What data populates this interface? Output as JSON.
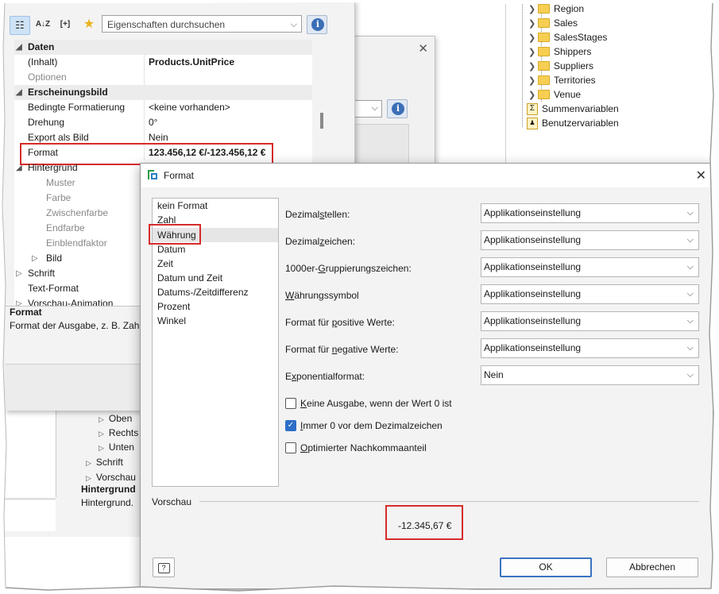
{
  "tree": {
    "items": [
      {
        "label": "Region"
      },
      {
        "label": "Sales"
      },
      {
        "label": "SalesStages"
      },
      {
        "label": "Shippers"
      },
      {
        "label": "Suppliers"
      },
      {
        "label": "Territories"
      },
      {
        "label": "Venue"
      }
    ],
    "sum_vars": "Summenvariablen",
    "user_vars": "Benutzervariablen"
  },
  "props": {
    "search_placeholder": "Eigenschaften durchsuchen",
    "sort_icon_label": "A↓Z",
    "bracket_label": "[+]",
    "rows": [
      {
        "key": "Daten",
        "value": ""
      },
      {
        "key": "(Inhalt)",
        "value": "Products.UnitPrice"
      },
      {
        "key": "Optionen",
        "value": ""
      },
      {
        "key": "Erscheinungsbild",
        "value": ""
      },
      {
        "key": "Bedingte Formatierung",
        "value": "<keine vorhanden>"
      },
      {
        "key": "Drehung",
        "value": "0°"
      },
      {
        "key": "Export als Bild",
        "value": "Nein"
      },
      {
        "key": "Format",
        "value": "123.456,12 €/-123.456,12 €"
      },
      {
        "key": "Hintergrund",
        "value": ""
      },
      {
        "key": "Muster",
        "value": ""
      },
      {
        "key": "Farbe",
        "value": ""
      },
      {
        "key": "Zwischenfarbe",
        "value": ""
      },
      {
        "key": "Endfarbe",
        "value": ""
      },
      {
        "key": "Einblendfaktor",
        "value": ""
      },
      {
        "key": "Bild",
        "value": ""
      },
      {
        "key": "Schrift",
        "value": ""
      },
      {
        "key": "Text-Format",
        "value": ""
      },
      {
        "key": "Vorschau-Animation",
        "value": ""
      }
    ],
    "desc_title": "Format",
    "desc_text": "Format der Ausgabe, z. B. Zah"
  },
  "background": {
    "items": [
      "Oben",
      "Rechts",
      "Unten",
      "Schrift",
      "Vorschau"
    ],
    "desc_title": "Hintergrund",
    "desc_text": "Hintergrund."
  },
  "format_dialog": {
    "title": "Format",
    "types": [
      "kein Format",
      "Zahl",
      "Währung",
      "Datum",
      "Zeit",
      "Datum und Zeit",
      "Datums-/Zeitdifferenz",
      "Prozent",
      "Winkel"
    ],
    "selected_type": "Währung",
    "fields": [
      {
        "pre": "Dezimal",
        "ul": "s",
        "post": "tellen:",
        "value": "Applikationseinstellung"
      },
      {
        "pre": "Dezimal",
        "ul": "z",
        "post": "eichen:",
        "value": "Applikationseinstellung"
      },
      {
        "pre": "1000er-",
        "ul": "G",
        "post": "ruppierungszeichen:",
        "value": "Applikationseinstellung"
      },
      {
        "pre": "",
        "ul": "W",
        "post": "ährungssymbol",
        "value": "Applikationseinstellung"
      },
      {
        "pre": "Format für ",
        "ul": "p",
        "post": "ositive Werte:",
        "value": "Applikationseinstellung"
      },
      {
        "pre": "Format für ",
        "ul": "n",
        "post": "egative Werte:",
        "value": "Applikationseinstellung"
      },
      {
        "pre": "E",
        "ul": "x",
        "post": "ponentialformat:",
        "value": "Nein"
      }
    ],
    "checkboxes": [
      {
        "ul": "K",
        "post": "eine Ausgabe, wenn der Wert 0 ist",
        "checked": false
      },
      {
        "ul": "I",
        "post": "mmer 0 vor dem Dezimalzeichen",
        "checked": true
      },
      {
        "ul": "O",
        "post": "ptimierter Nachkommaanteil",
        "checked": false
      }
    ],
    "preview_label": "Vorschau",
    "preview_value": "-12.345,67 €",
    "ok_label": "OK",
    "cancel_label": "Abbrechen",
    "help_icon": "help-icon"
  },
  "colors": {
    "highlight": "#d62b2b",
    "accent": "#2d6ec8",
    "folder": "#f6cf52"
  }
}
